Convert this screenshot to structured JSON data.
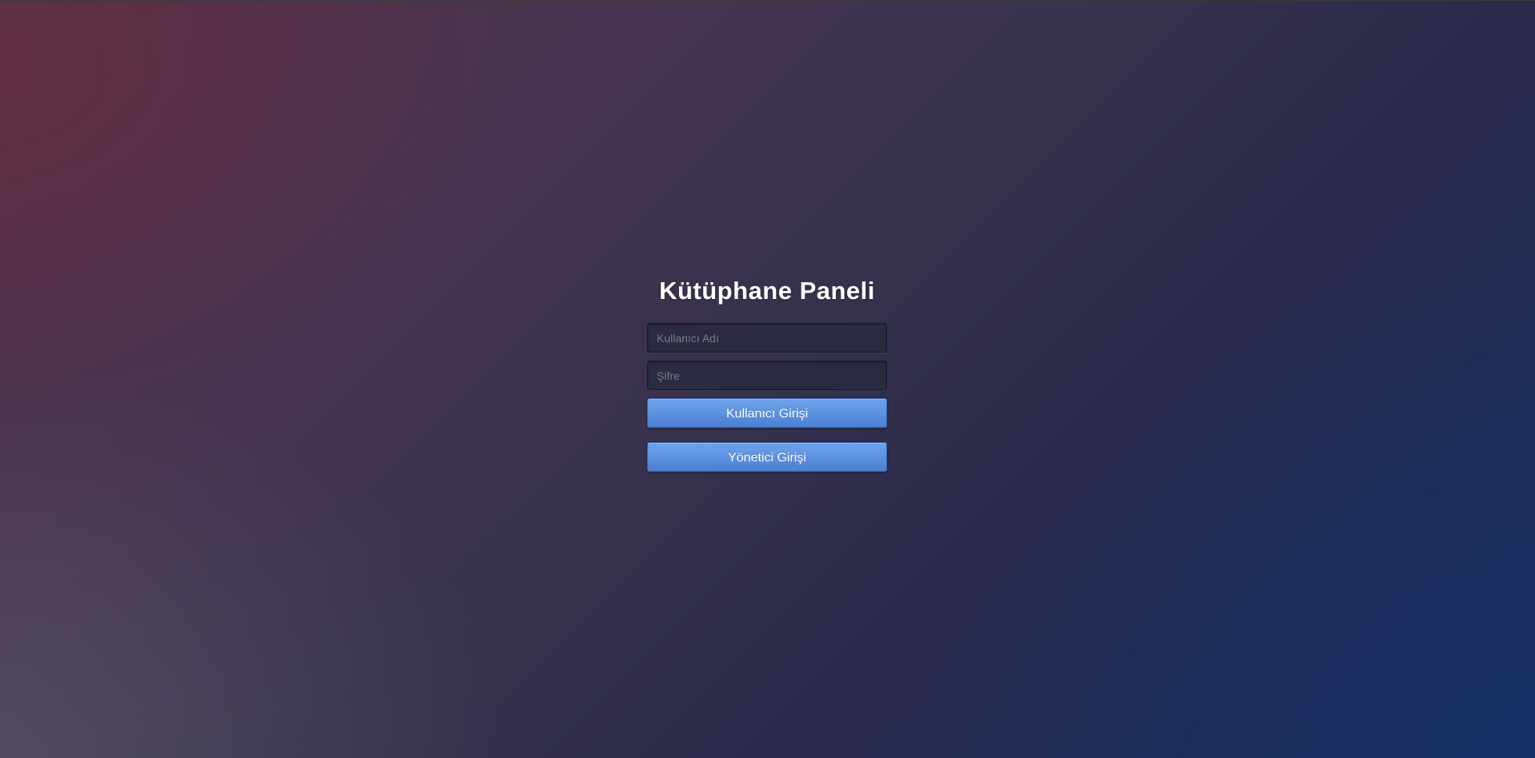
{
  "login": {
    "title": "Kütüphane Paneli",
    "username_placeholder": "Kullanıcı Adı",
    "username_value": "",
    "password_placeholder": "Şifre",
    "password_value": "",
    "user_login_label": "Kullanıcı Girişi",
    "admin_login_label": "Yönetici Girişi"
  },
  "colors": {
    "button_accent": "#5d92e0",
    "input_background": "#2a2a40",
    "title_text": "#ffffff"
  }
}
